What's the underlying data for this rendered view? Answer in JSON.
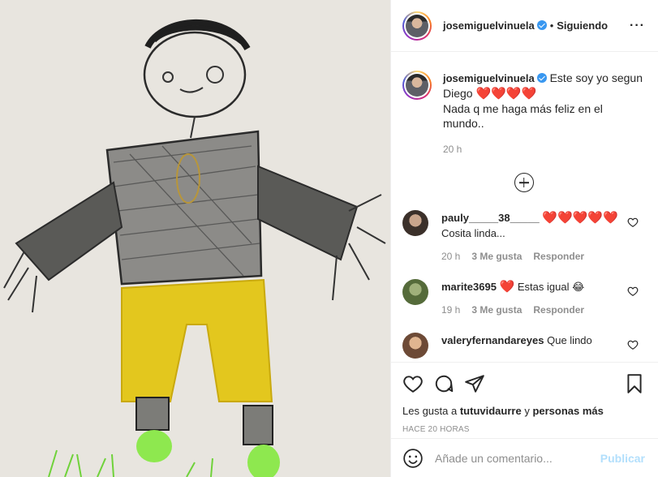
{
  "post": {
    "username": "josemiguelvinuela",
    "verified": true,
    "separator": "•",
    "follow_label": "Siguiendo",
    "more_label": "···"
  },
  "caption": {
    "username": "josemiguelvinuela",
    "line1": "Este soy yo segun Diego",
    "hearts": "❤️❤️❤️❤️",
    "line2": "Nada q me haga más feliz en el mundo..",
    "time": "20 h"
  },
  "comments": [
    {
      "username": "pauly_____38_____",
      "hearts": "❤️❤️❤️❤️❤️",
      "text": "Cosita linda...",
      "time": "20 h",
      "likes": "3 Me gusta",
      "reply": "Responder"
    },
    {
      "username": "marite3695",
      "hearts": "❤️",
      "text": "Estas igual 😂",
      "time": "19 h",
      "likes": "3 Me gusta",
      "reply": "Responder"
    },
    {
      "username": "valeryfernandareyes",
      "hearts": "",
      "text": "Que lindo",
      "time": "",
      "likes": "",
      "reply": ""
    }
  ],
  "likes": {
    "prefix": "Les gusta a",
    "user": "tutuvidaurre",
    "joiner": "y",
    "others": "personas más"
  },
  "date": "HACE 20 HORAS",
  "add_comment": {
    "placeholder": "Añade un comentario...",
    "emoji_icon": "smiley-icon",
    "publish_label": "Publicar"
  },
  "colors": {
    "verified": "#3897f0",
    "link_disabled": "#b2dffc",
    "heart": "#e0173b"
  }
}
